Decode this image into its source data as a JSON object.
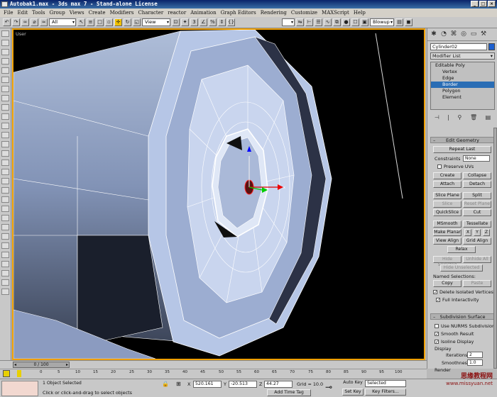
{
  "window": {
    "title": "Autobak1.max - 3ds max 7 - Stand-alone License"
  },
  "menu": [
    "File",
    "Edit",
    "Tools",
    "Group",
    "Views",
    "Create",
    "Modifiers",
    "Character",
    "reactor",
    "Animation",
    "Graph Editors",
    "Rendering",
    "Customize",
    "MAXScript",
    "Help"
  ],
  "toolbar": {
    "selection_filter": "All",
    "ref_coord": "View",
    "render_type": "Blowup"
  },
  "viewport": {
    "label": "User"
  },
  "panel": {
    "object_name": "Cylinder02",
    "object_color": "#1c5fcf",
    "modifier_list": "Modifier List",
    "stack": {
      "base": "Editable Poly",
      "subs": [
        "Vertex",
        "Edge",
        "Border",
        "Polygon",
        "Element"
      ],
      "selected": "Border"
    },
    "edit_geometry": {
      "title": "Edit Geometry",
      "repeat_last": "Repeat Last",
      "constraints_label": "Constraints",
      "constraints_value": "None",
      "preserve_uvs": "Preserve UVs",
      "create": "Create",
      "collapse": "Collapse",
      "attach": "Attach",
      "detach": "Detach",
      "slice_plane": "Slice Plane",
      "split": "Split",
      "slice": "Slice",
      "reset_plane": "Reset Plane",
      "quickslice": "QuickSlice",
      "cut": "Cut",
      "msmooth": "MSmooth",
      "tessellate": "Tessellate",
      "make_planar": "Make Planar",
      "x": "X",
      "y": "Y",
      "z": "Z",
      "view_align": "View Align",
      "grid_align": "Grid Align",
      "relax": "Relax",
      "hide_selected": "Hide Selected",
      "unhide_all": "Unhide All",
      "hide_unselected": "Hide Unselected",
      "named_selections": "Named Selections:",
      "copy": "Copy",
      "paste": "Paste",
      "delete_isolated": "Delete Isolated Vertices",
      "full_interactivity": "Full Interactivity"
    },
    "subdivision": {
      "title": "Subdivision Surface",
      "use_nurms": "Use NURMS Subdivision",
      "smooth_result": "Smooth Result",
      "isoline_display": "Isoline Display",
      "display_label": "Display",
      "iterations_label": "Iterations:",
      "iterations_value": "2",
      "smoothness_label": "Smoothness:",
      "smoothness_value": "1.0",
      "render_label": "Render"
    }
  },
  "timeline": {
    "frame": "0 / 100",
    "ticks": [
      "0",
      "5",
      "10",
      "15",
      "20",
      "25",
      "30",
      "35",
      "40",
      "45",
      "50",
      "55",
      "60",
      "65",
      "70",
      "75",
      "80",
      "85",
      "90",
      "95",
      "100"
    ]
  },
  "status": {
    "selected_text": "1 Object Selected",
    "prompt": "Click or click-and-drag to select objects",
    "x_label": "X",
    "x_value": "520.161",
    "y_label": "Y",
    "y_value": "-20.513",
    "z_label": "Z",
    "z_value": "44.27",
    "grid": "Grid = 10.0",
    "add_time_tag": "Add Time Tag",
    "auto_key": "Auto Key",
    "set_key": "Set Key",
    "key_mode": "Selected",
    "key_filters": "Key Filters..."
  },
  "watermark": {
    "line1": "思缘教程网",
    "line2": "www.missyuan.net"
  }
}
